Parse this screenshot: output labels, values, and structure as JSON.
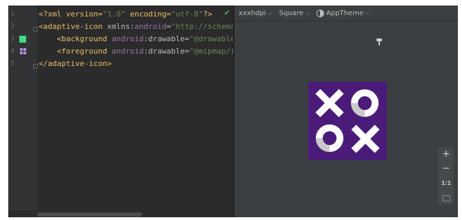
{
  "editor": {
    "line_numbers": [
      "1",
      "2",
      "3",
      "4",
      "5"
    ],
    "lines": [
      {
        "parts": [
          {
            "t": "<?xml version=",
            "c": "pi"
          },
          {
            "t": "\"1.0\"",
            "c": "val"
          },
          {
            "t": " encoding=",
            "c": "pi"
          },
          {
            "t": "\"utf-8\"",
            "c": "val"
          },
          {
            "t": "?>",
            "c": "pi"
          }
        ]
      },
      {
        "parts": [
          {
            "t": "<adaptive-icon ",
            "c": "tag"
          },
          {
            "t": "xmlns:",
            "c": "attr"
          },
          {
            "t": "android",
            "c": "ns"
          },
          {
            "t": "=",
            "c": "attr"
          },
          {
            "t": "\"http://schemas.a",
            "c": "val"
          }
        ]
      },
      {
        "parts": [
          {
            "t": "    <background ",
            "c": "tag"
          },
          {
            "t": "android",
            "c": "ns"
          },
          {
            "t": ":drawable=",
            "c": "attr"
          },
          {
            "t": "\"@drawable/ic",
            "c": "val"
          }
        ]
      },
      {
        "parts": [
          {
            "t": "    <foreground ",
            "c": "tag"
          },
          {
            "t": "android",
            "c": "ns"
          },
          {
            "t": ":drawable=",
            "c": "attr"
          },
          {
            "t": "\"@mipmap/ic_",
            "c": "val"
          }
        ]
      },
      {
        "parts": [
          {
            "t": "</adaptive-icon>",
            "c": "tag"
          }
        ]
      }
    ],
    "status_icon": "check-icon"
  },
  "preview": {
    "density": "xxxhdpi",
    "shape": "Square",
    "theme": "AppTheme",
    "icon_colors": {
      "background": "#4b1b79",
      "glyph": "#ffffff",
      "shade": "#c9c9c9"
    },
    "zoom": {
      "in_label": "+",
      "out_label": "−",
      "actual_label": "1:1"
    }
  },
  "colors": {
    "editor_bg": "#2b2b2b",
    "gutter_bg": "#313335",
    "preview_bg": "#3c3f41",
    "background_swatch": "#41d983",
    "foreground_swatch": "#b58cdf"
  }
}
